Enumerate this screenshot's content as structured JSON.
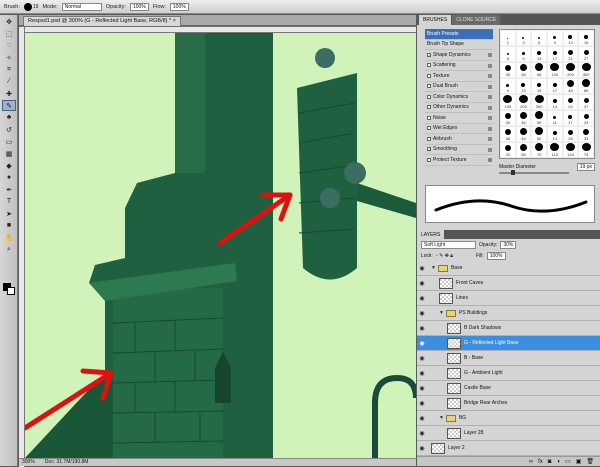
{
  "options_bar": {
    "brush_label": "Brush:",
    "brush_size": "19",
    "mode_label": "Mode:",
    "mode_value": "Normal",
    "opacity_label": "Opacity:",
    "opacity_value": "100%",
    "flow_label": "Flow:",
    "flow_value": "100%"
  },
  "document": {
    "tab_title": "Respsd1.psd @ 300% (G - Reflected Light Base, RGB/8) *",
    "zoom": "300%",
    "doc_info": "Doc: 31.7M/190.8M"
  },
  "tools": [
    "move-icon",
    "marquee-icon",
    "lasso-icon",
    "quick-select-icon",
    "crop-icon",
    "eyedropper-icon",
    "healing-icon",
    "brush-icon",
    "stamp-icon",
    "history-brush-icon",
    "eraser-icon",
    "gradient-icon",
    "blur-icon",
    "dodge-icon",
    "pen-icon",
    "type-icon",
    "path-select-icon",
    "shape-icon",
    "hand-icon",
    "zoom-icon"
  ],
  "brush_panel": {
    "tabs": [
      "BRUSHES",
      "CLONE SOURCE"
    ],
    "options": [
      {
        "label": "Brush Presets",
        "checked": false,
        "selected": true
      },
      {
        "label": "Brush Tip Shape",
        "checked": false
      },
      {
        "label": "Shape Dynamics",
        "checked": true
      },
      {
        "label": "Scattering",
        "checked": false
      },
      {
        "label": "Texture",
        "checked": false
      },
      {
        "label": "Dual Brush",
        "checked": false
      },
      {
        "label": "Color Dynamics",
        "checked": false
      },
      {
        "label": "Other Dynamics",
        "checked": false
      },
      {
        "label": "Noise",
        "checked": false
      },
      {
        "label": "Wet Edges",
        "checked": false
      },
      {
        "label": "Airbrush",
        "checked": false
      },
      {
        "label": "Smoothing",
        "checked": true
      },
      {
        "label": "Protect Texture",
        "checked": false
      }
    ],
    "presets": [
      "1",
      "3",
      "5",
      "9",
      "13",
      "19",
      "5",
      "9",
      "13",
      "17",
      "21",
      "27",
      "35",
      "45",
      "65",
      "100",
      "200",
      "300",
      "9",
      "13",
      "19",
      "17",
      "45",
      "65",
      "100",
      "200",
      "300",
      "14",
      "24",
      "27",
      "39",
      "46",
      "59",
      "11",
      "17",
      "23",
      "36",
      "44",
      "60",
      "14",
      "26",
      "33",
      "42",
      "55",
      "70",
      "112",
      "134",
      "74",
      "95",
      "29",
      "192",
      "36",
      "36",
      "33",
      "63",
      "66",
      "39",
      "63",
      "11",
      "48",
      "32",
      "55",
      "100",
      "75",
      "45"
    ],
    "master_diameter_label": "Master Diameter",
    "master_diameter_value": "19 px"
  },
  "layers_panel": {
    "tab": "LAYERS",
    "blend_mode": "Soft Light",
    "opacity_label": "Opacity:",
    "opacity_value": "30%",
    "lock_label": "Lock:",
    "fill_label": "Fill:",
    "fill_value": "100%",
    "layers": [
      {
        "name": "Base",
        "type": "group",
        "indent": 0
      },
      {
        "name": "Front Caves",
        "type": "layer",
        "indent": 1
      },
      {
        "name": "Lines",
        "type": "layer",
        "indent": 1
      },
      {
        "name": "PS Buildings",
        "type": "group",
        "indent": 1
      },
      {
        "name": "B Dark Shadows",
        "type": "layer",
        "indent": 2
      },
      {
        "name": "G - Reflected Light Base",
        "type": "layer",
        "indent": 2,
        "selected": true
      },
      {
        "name": "B - Base",
        "type": "layer",
        "indent": 2
      },
      {
        "name": "G - Ambient Light",
        "type": "layer",
        "indent": 2
      },
      {
        "name": "Castle Base",
        "type": "layer",
        "indent": 2
      },
      {
        "name": "Bridge Rear Arches",
        "type": "layer",
        "indent": 2
      },
      {
        "name": "BG",
        "type": "group",
        "indent": 1
      },
      {
        "name": "Layer 28",
        "type": "layer",
        "indent": 2
      },
      {
        "name": "Layer 2",
        "type": "layer",
        "indent": 0
      }
    ]
  },
  "colors": {
    "canvas_bg": "#c8f0b0",
    "tower": "#1f6040",
    "selection": "#3c8ee0",
    "arrow": "#e01010"
  }
}
